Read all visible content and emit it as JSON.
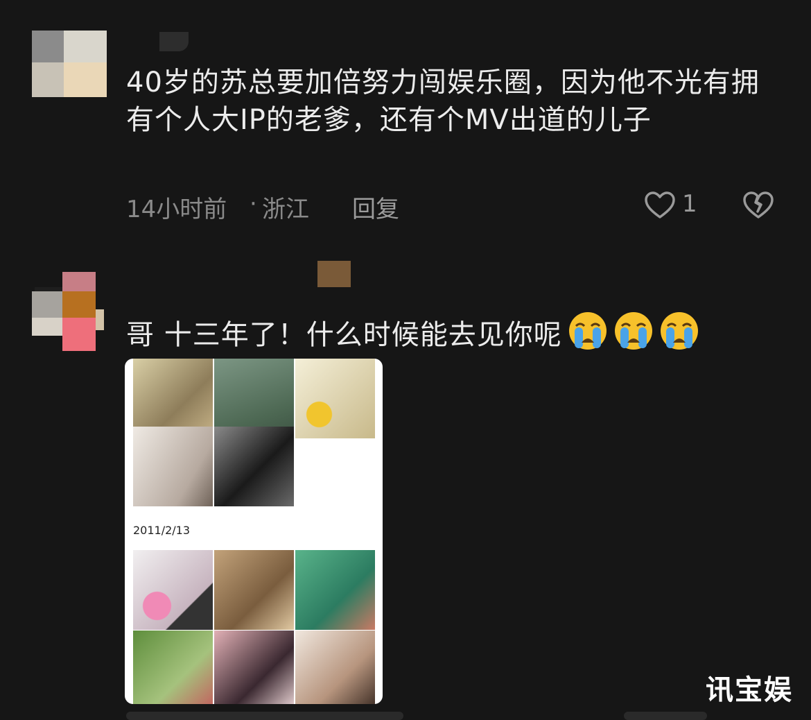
{
  "comments": [
    {
      "text": "40岁的苏总要加倍努力闯娱乐圈，因为他不光有拥有个人大IP的老爹，还有个MV出道的儿子",
      "time": "14小时前",
      "separator": "·",
      "location": "浙江",
      "reply_label": "回复",
      "like_count": "1"
    },
    {
      "text": "哥 十三年了！什么时候能去见你呢",
      "emoji": [
        "loudly-crying-face",
        "loudly-crying-face",
        "loudly-crying-face"
      ],
      "attachment": {
        "date_text": "2011/2/13",
        "thumb_colors": [
          "#b9b08a",
          "#5f7a63",
          "#e6dbb0",
          "#d9d3cc",
          "#3a3a3a",
          "#d8c9d6",
          "#a88a5e",
          "#4a9a6b",
          "#6e8f4a",
          "#b58a8a",
          "#d7c7b9"
        ]
      }
    }
  ],
  "watermark": "讯宝娱",
  "colors": {
    "background": "#161616",
    "text": "#ececec",
    "meta": "#8a8a8a",
    "emoji_face": "#f7c12b",
    "emoji_tear": "#4aa3e8"
  }
}
